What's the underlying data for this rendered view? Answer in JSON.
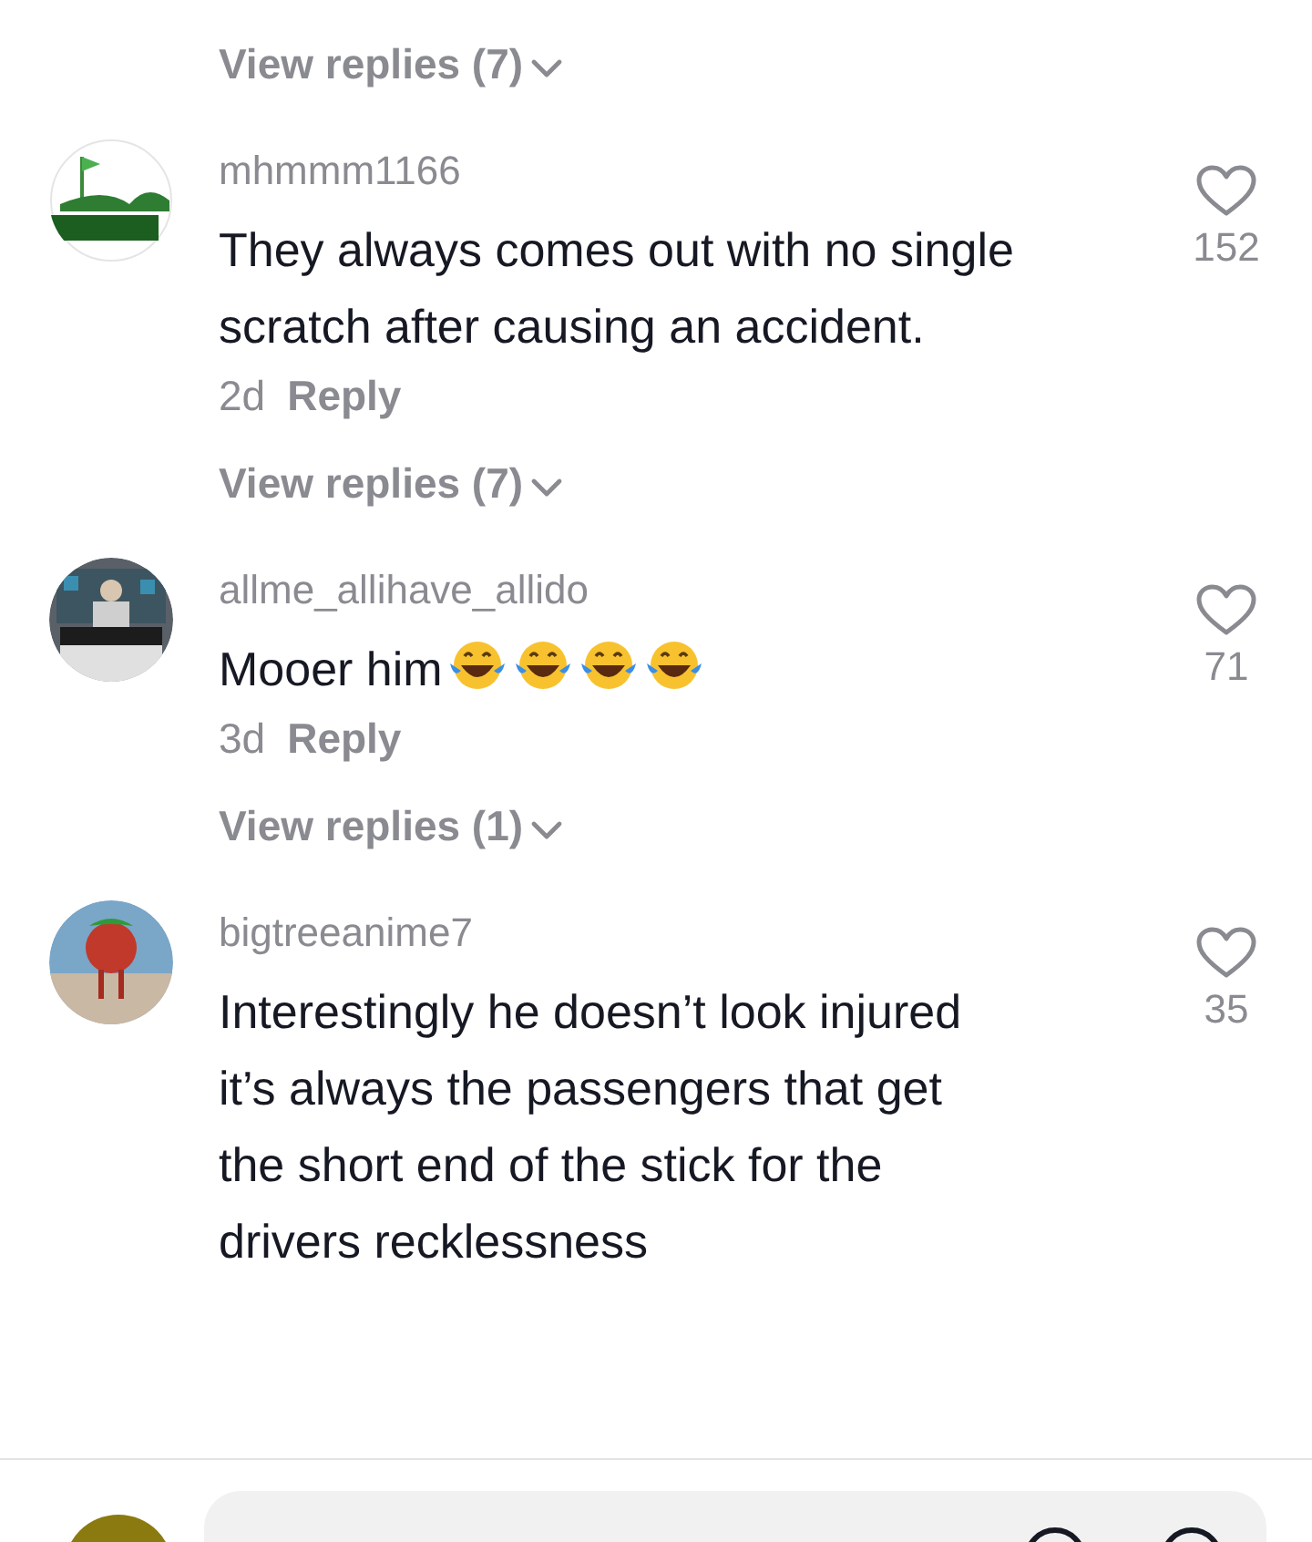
{
  "top_view_replies": "View replies (7)",
  "comments": [
    {
      "avatar": {
        "kind": "logo"
      },
      "username": "mhmmm1166",
      "text": "They always comes out with no single scratch after causing an accident.",
      "age": "2d",
      "reply": "Reply",
      "likes": "152",
      "liked": false,
      "view_replies": "View replies (7)"
    },
    {
      "username": "allme_allihave_allido",
      "text": "Mooer him",
      "emojis": [
        {
          "kind": "laugh"
        },
        {
          "kind": "laugh"
        },
        {
          "kind": "laugh"
        },
        {
          "kind": "laugh"
        }
      ],
      "age": "3d",
      "reply": "Reply",
      "likes": "71",
      "liked": false,
      "view_replies": "View replies (1)"
    },
    {
      "avatar": {
        "kind": "figure"
      },
      "username": "bigtreeanime7",
      "text": "Interestingly he doesn’t look injured it’s always the passengers that get the short end of the stick for the drivers recklessness",
      "likes": "35",
      "liked": false
    }
  ]
}
